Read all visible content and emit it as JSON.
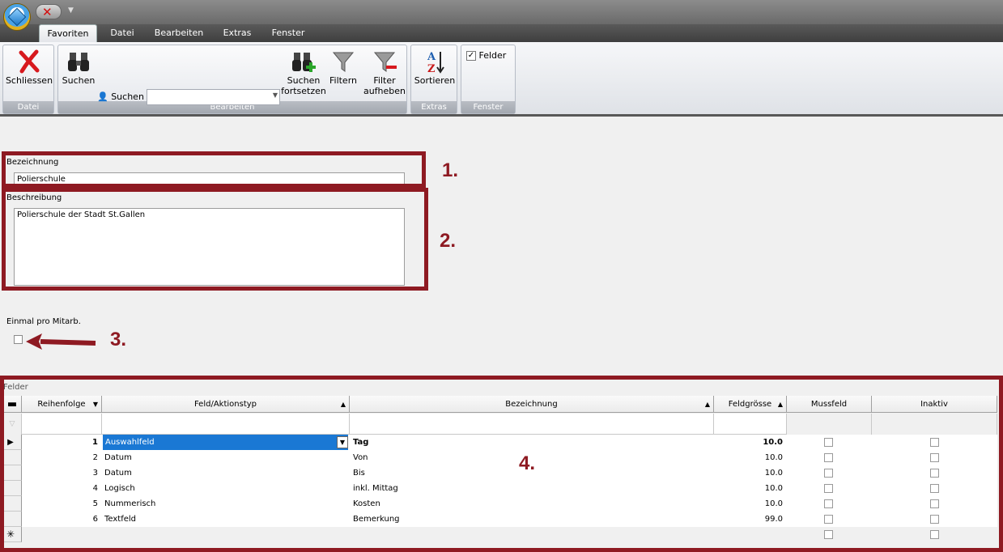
{
  "ribbon_tabs": [
    "Favoriten",
    "Datei",
    "Bearbeiten",
    "Extras",
    "Fenster"
  ],
  "ribbon": {
    "schliessen": "Schliessen",
    "suchen_big": "Suchen",
    "suchen_label": "Suchen",
    "suchen_fortsetzen_1": "Suchen",
    "suchen_fortsetzen_2": "fortsetzen",
    "filtern": "Filtern",
    "filter_aufheben_1": "Filter",
    "filter_aufheben_2": "aufheben",
    "sortieren": "Sortieren",
    "felder": "Felder",
    "group_datei": "Datei",
    "group_bearbeiten": "Bearbeiten",
    "group_extras": "Extras",
    "group_fenster": "Fenster"
  },
  "form": {
    "bezeichnung_label": "Bezeichnung",
    "bezeichnung_value": "Polierschule",
    "beschreibung_label": "Beschreibung",
    "beschreibung_value": "Polierschule der Stadt St.Gallen",
    "einmal_label": "Einmal pro Mitarb."
  },
  "annotations": {
    "n1": "1.",
    "n2": "2.",
    "n3": "3.",
    "n4": "4.",
    "color": "#8e1a22"
  },
  "grid": {
    "title": "Felder",
    "headers": {
      "reihenfolge": "Reihenfolge",
      "feld": "Feld/Aktionstyp",
      "bezeichnung": "Bezeichnung",
      "feldgroesse": "Feldgrösse",
      "mussfeld": "Mussfeld",
      "inaktiv": "Inaktiv"
    },
    "rows": [
      {
        "nr": "1",
        "typ": "Auswahlfeld",
        "bez": "Tag",
        "size": "10.0"
      },
      {
        "nr": "2",
        "typ": "Datum",
        "bez": "Von",
        "size": "10.0"
      },
      {
        "nr": "3",
        "typ": "Datum",
        "bez": "Bis",
        "size": "10.0"
      },
      {
        "nr": "4",
        "typ": "Logisch",
        "bez": "inkl. Mittag",
        "size": "10.0"
      },
      {
        "nr": "5",
        "typ": "Nummerisch",
        "bez": "Kosten",
        "size": "10.0"
      },
      {
        "nr": "6",
        "typ": "Textfeld",
        "bez": "Bemerkung",
        "size": "99.0"
      }
    ]
  }
}
